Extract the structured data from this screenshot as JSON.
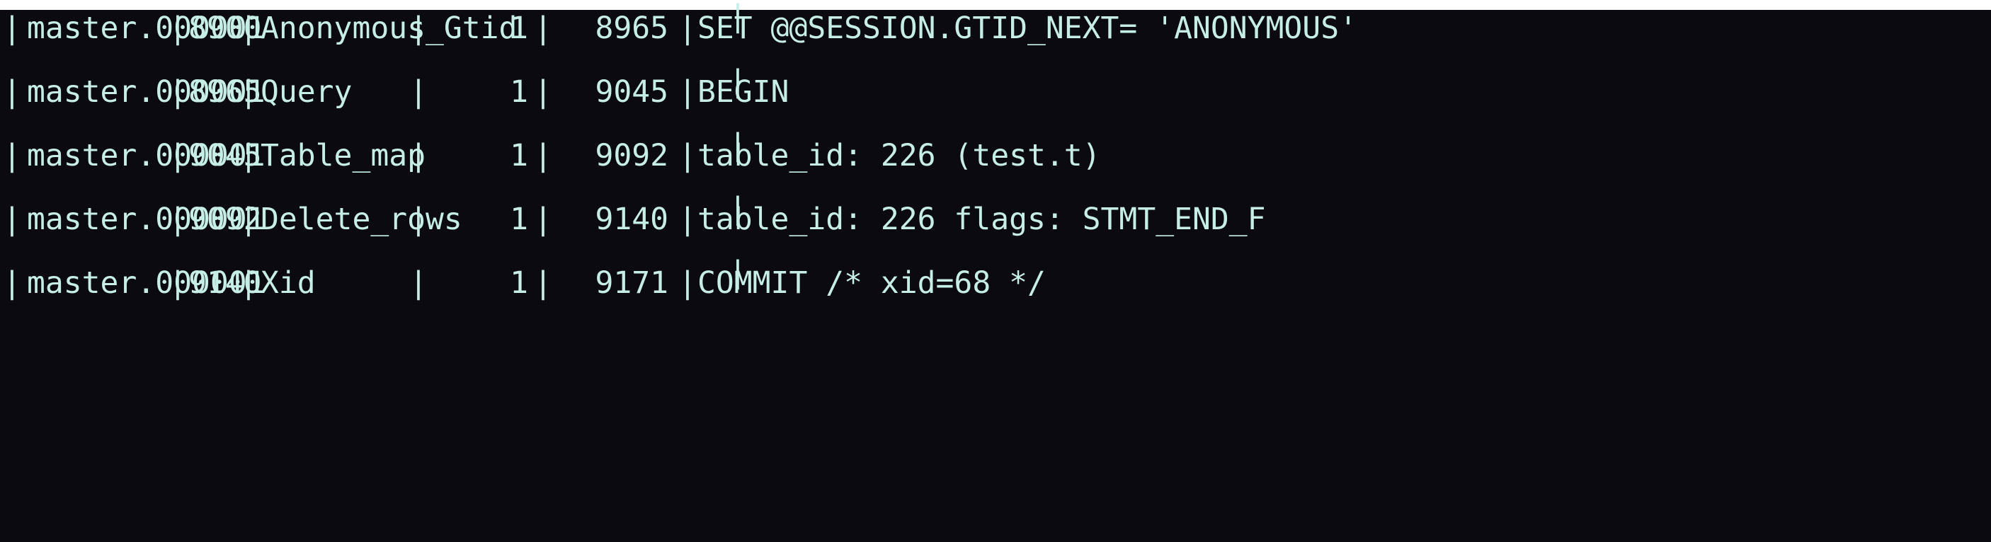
{
  "terminal": {
    "rows": [
      {
        "log_name": "master.000001",
        "pos": "8900",
        "event_type": "Anonymous_Gtid",
        "server_id": "1",
        "end_log_pos": "8965",
        "info": "SET @@SESSION.GTID_NEXT= 'ANONYMOUS'"
      },
      {
        "log_name": "master.000001",
        "pos": "8965",
        "event_type": "Query",
        "server_id": "1",
        "end_log_pos": "9045",
        "info": "BEGIN"
      },
      {
        "log_name": "master.000001",
        "pos": "9045",
        "event_type": "Table_map",
        "server_id": "1",
        "end_log_pos": "9092",
        "info": "table_id: 226 (test.t)"
      },
      {
        "log_name": "master.000001",
        "pos": "9092",
        "event_type": "Delete_rows",
        "server_id": "1",
        "end_log_pos": "9140",
        "info": "table_id: 226 flags: STMT_END_F"
      },
      {
        "log_name": "master.000001",
        "pos": "9140",
        "event_type": "Xid",
        "server_id": "1",
        "end_log_pos": "9171",
        "info": "COMMIT /* xid=68 */"
      }
    ],
    "separator": "|",
    "colors": {
      "background": "#0b0a10",
      "text": "#c7eee6"
    }
  }
}
